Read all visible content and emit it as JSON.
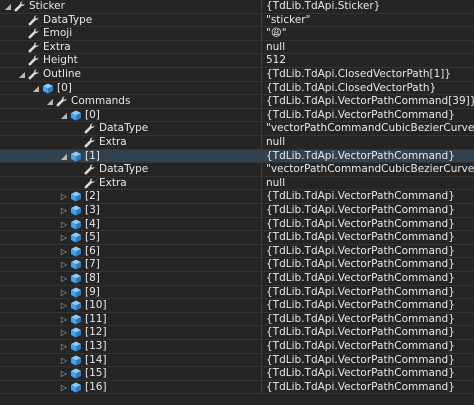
{
  "icons": {
    "property": "wrench-icon",
    "object": "cube-icon",
    "expanded": "triangle-expanded-icon",
    "collapsed": "triangle-collapsed-icon"
  },
  "colors": {
    "background": "#252526",
    "selected_row": "#33424f",
    "text": "#e8e8e8",
    "object_icon": "#4aa3e8"
  },
  "rows": [
    {
      "name": "Sticker",
      "value": "{TdLib.TdApi.Sticker}",
      "level": 0,
      "expander": "expanded",
      "icon": "property"
    },
    {
      "name": "DataType",
      "value": "\"sticker\"",
      "level": 1,
      "expander": "none",
      "icon": "property"
    },
    {
      "name": "Emoji",
      "value": "\"😩\"",
      "level": 1,
      "expander": "none",
      "icon": "property"
    },
    {
      "name": "Extra",
      "value": "null",
      "level": 1,
      "expander": "none",
      "icon": "property"
    },
    {
      "name": "Height",
      "value": "512",
      "level": 1,
      "expander": "none",
      "icon": "property"
    },
    {
      "name": "Outline",
      "value": "{TdLib.TdApi.ClosedVectorPath[1]}",
      "level": 1,
      "expander": "expanded",
      "icon": "property"
    },
    {
      "name": "[0]",
      "value": "{TdLib.TdApi.ClosedVectorPath}",
      "level": 2,
      "expander": "expanded",
      "icon": "object"
    },
    {
      "name": "Commands",
      "value": "{TdLib.TdApi.VectorPathCommand[39]}",
      "level": 3,
      "expander": "expanded",
      "icon": "property"
    },
    {
      "name": "[0]",
      "value": "{TdLib.TdApi.VectorPathCommand}",
      "level": 4,
      "expander": "expanded",
      "icon": "object"
    },
    {
      "name": "DataType",
      "value": "\"vectorPathCommandCubicBezierCurve\"",
      "level": 5,
      "expander": "none",
      "icon": "property"
    },
    {
      "name": "Extra",
      "value": "null",
      "level": 5,
      "expander": "none",
      "icon": "property"
    },
    {
      "name": "[1]",
      "value": "{TdLib.TdApi.VectorPathCommand}",
      "level": 4,
      "expander": "expanded",
      "icon": "object",
      "selected": true
    },
    {
      "name": "DataType",
      "value": "\"vectorPathCommandCubicBezierCurve\"",
      "level": 5,
      "expander": "none",
      "icon": "property"
    },
    {
      "name": "Extra",
      "value": "null",
      "level": 5,
      "expander": "none",
      "icon": "property"
    },
    {
      "name": "[2]",
      "value": "{TdLib.TdApi.VectorPathCommand}",
      "level": 4,
      "expander": "collapsed",
      "icon": "object"
    },
    {
      "name": "[3]",
      "value": "{TdLib.TdApi.VectorPathCommand}",
      "level": 4,
      "expander": "collapsed",
      "icon": "object"
    },
    {
      "name": "[4]",
      "value": "{TdLib.TdApi.VectorPathCommand}",
      "level": 4,
      "expander": "collapsed",
      "icon": "object"
    },
    {
      "name": "[5]",
      "value": "{TdLib.TdApi.VectorPathCommand}",
      "level": 4,
      "expander": "collapsed",
      "icon": "object"
    },
    {
      "name": "[6]",
      "value": "{TdLib.TdApi.VectorPathCommand}",
      "level": 4,
      "expander": "collapsed",
      "icon": "object"
    },
    {
      "name": "[7]",
      "value": "{TdLib.TdApi.VectorPathCommand}",
      "level": 4,
      "expander": "collapsed",
      "icon": "object"
    },
    {
      "name": "[8]",
      "value": "{TdLib.TdApi.VectorPathCommand}",
      "level": 4,
      "expander": "collapsed",
      "icon": "object"
    },
    {
      "name": "[9]",
      "value": "{TdLib.TdApi.VectorPathCommand}",
      "level": 4,
      "expander": "collapsed",
      "icon": "object"
    },
    {
      "name": "[10]",
      "value": "{TdLib.TdApi.VectorPathCommand}",
      "level": 4,
      "expander": "collapsed",
      "icon": "object"
    },
    {
      "name": "[11]",
      "value": "{TdLib.TdApi.VectorPathCommand}",
      "level": 4,
      "expander": "collapsed",
      "icon": "object"
    },
    {
      "name": "[12]",
      "value": "{TdLib.TdApi.VectorPathCommand}",
      "level": 4,
      "expander": "collapsed",
      "icon": "object"
    },
    {
      "name": "[13]",
      "value": "{TdLib.TdApi.VectorPathCommand}",
      "level": 4,
      "expander": "collapsed",
      "icon": "object"
    },
    {
      "name": "[14]",
      "value": "{TdLib.TdApi.VectorPathCommand}",
      "level": 4,
      "expander": "collapsed",
      "icon": "object"
    },
    {
      "name": "[15]",
      "value": "{TdLib.TdApi.VectorPathCommand}",
      "level": 4,
      "expander": "collapsed",
      "icon": "object"
    },
    {
      "name": "[16]",
      "value": "{TdLib.TdApi.VectorPathCommand}",
      "level": 4,
      "expander": "collapsed",
      "icon": "object"
    }
  ]
}
